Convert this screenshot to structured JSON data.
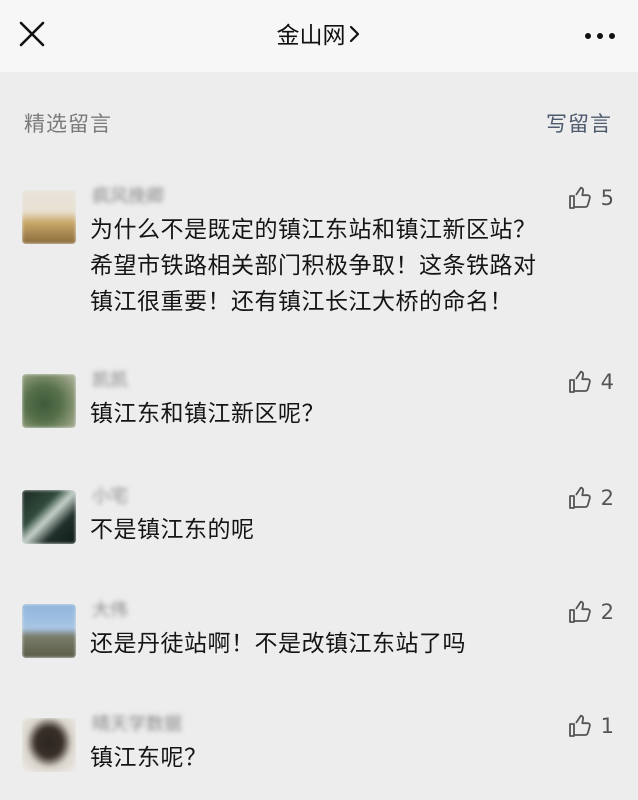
{
  "header": {
    "title": "金山网",
    "close_icon": "close-icon",
    "chevron_icon": "chevron-right-icon",
    "more_icon": "more-horizontal-icon"
  },
  "section": {
    "title": "精选留言",
    "write_label": "写留言"
  },
  "comments": [
    {
      "nickname": "疯风挽卿",
      "content": "为什么不是既定的镇江东站和镇江新区站？\n希望市铁路相关部门积极争取！这条铁路对\n镇江很重要！还有镇江长江大桥的命名！",
      "likes": "5"
    },
    {
      "nickname": "凯凯",
      "content": "镇江东和镇江新区呢？",
      "likes": "4"
    },
    {
      "nickname": "小宅",
      "content": "不是镇江东的呢",
      "likes": "2"
    },
    {
      "nickname": "大伟",
      "content": "还是丹徒站啊！不是改镇江东站了吗",
      "likes": "2"
    },
    {
      "nickname": "晴天学数据",
      "content": "镇江东呢？",
      "likes": "1"
    }
  ],
  "colors": {
    "background": "#ededed",
    "topbar": "#f7f7f7",
    "link": "#4e5a6e",
    "muted": "#7a7a7a"
  }
}
